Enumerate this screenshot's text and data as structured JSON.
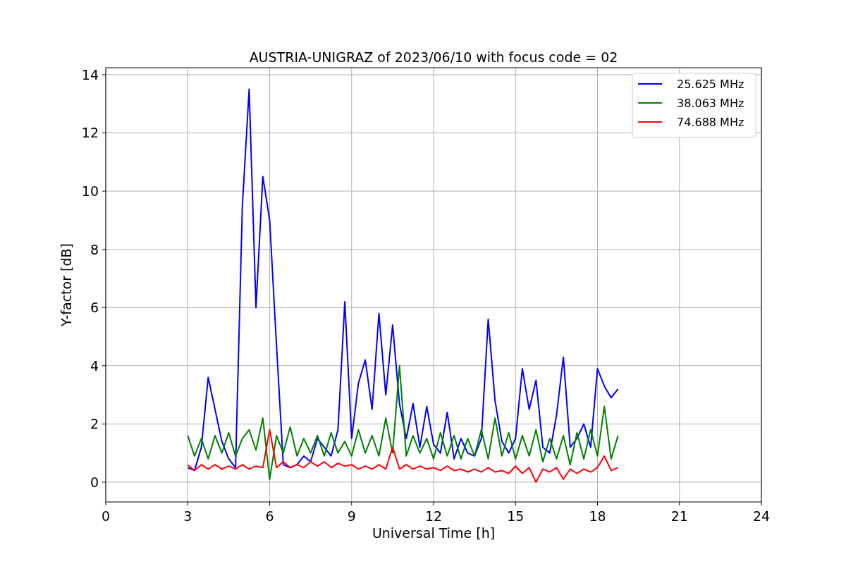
{
  "chart_data": {
    "type": "line",
    "title": "AUSTRIA-UNIGRAZ of 2023/06/10 with focus code = 02",
    "xlabel": "Universal Time [h]",
    "ylabel": "Y-factor [dB]",
    "x": [
      3,
      3.25,
      3.5,
      3.75,
      4,
      4.25,
      4.5,
      4.75,
      5,
      5.25,
      5.5,
      5.75,
      6,
      6.25,
      6.5,
      6.75,
      7,
      7.25,
      7.5,
      7.75,
      8,
      8.25,
      8.5,
      8.75,
      9,
      9.25,
      9.5,
      9.75,
      10,
      10.25,
      10.5,
      10.75,
      11,
      11.25,
      11.5,
      11.75,
      12,
      12.25,
      12.5,
      12.75,
      13,
      13.25,
      13.5,
      13.75,
      14,
      14.25,
      14.5,
      14.75,
      15,
      15.25,
      15.5,
      15.75,
      16,
      16.25,
      16.5,
      16.75,
      17,
      17.25,
      17.5,
      17.75,
      18,
      18.25,
      18.5,
      18.75
    ],
    "series": [
      {
        "name": "25.625 MHz",
        "color": "#0000ff",
        "values": [
          0.5,
          0.4,
          1.2,
          3.6,
          2.5,
          1.4,
          0.8,
          0.5,
          9.5,
          13.5,
          6,
          10.5,
          9.0,
          4.7,
          0.6,
          0.5,
          0.6,
          0.9,
          0.7,
          1.5,
          1.2,
          0.9,
          1.8,
          6.2,
          1.5,
          3.4,
          4.2,
          2.5,
          5.8,
          3.0,
          5.4,
          2.7,
          1.5,
          2.7,
          1.2,
          2.6,
          1.3,
          1.0,
          2.4,
          0.8,
          1.5,
          1.0,
          0.9,
          1.5,
          5.6,
          2.8,
          1.4,
          1.0,
          1.5,
          3.9,
          2.5,
          3.5,
          1.2,
          1.0,
          2.3,
          4.3,
          1.2,
          1.5,
          2.0,
          1.2,
          3.9,
          3.3,
          2.9,
          3.2
        ]
      },
      {
        "name": "38.063 MHz",
        "color": "#008000",
        "values": [
          1.6,
          0.9,
          1.5,
          0.8,
          1.6,
          1.0,
          1.7,
          0.9,
          1.5,
          1.8,
          1.1,
          2.2,
          0.1,
          1.6,
          1.0,
          1.9,
          0.9,
          1.5,
          1.0,
          1.6,
          0.9,
          1.7,
          1.0,
          1.4,
          0.9,
          1.8,
          1.0,
          1.6,
          0.9,
          2.2,
          1.0,
          4.0,
          0.9,
          1.6,
          1.0,
          1.5,
          0.8,
          1.7,
          0.9,
          1.6,
          0.8,
          1.5,
          0.9,
          1.8,
          0.8,
          2.2,
          0.9,
          1.7,
          0.8,
          1.6,
          0.9,
          1.8,
          0.7,
          1.5,
          0.8,
          1.6,
          0.6,
          1.7,
          0.8,
          1.8,
          0.9,
          2.6,
          0.8,
          1.6
        ]
      },
      {
        "name": "74.688 MHz",
        "color": "#ff0000",
        "values": [
          0.6,
          0.4,
          0.6,
          0.45,
          0.6,
          0.45,
          0.55,
          0.45,
          0.6,
          0.45,
          0.55,
          0.5,
          1.8,
          0.5,
          0.7,
          0.5,
          0.6,
          0.5,
          0.7,
          0.55,
          0.7,
          0.5,
          0.65,
          0.55,
          0.6,
          0.45,
          0.55,
          0.45,
          0.6,
          0.45,
          1.2,
          0.45,
          0.6,
          0.45,
          0.55,
          0.45,
          0.5,
          0.4,
          0.55,
          0.4,
          0.45,
          0.35,
          0.45,
          0.35,
          0.5,
          0.35,
          0.4,
          0.3,
          0.55,
          0.3,
          0.5,
          0.0,
          0.45,
          0.35,
          0.5,
          0.1,
          0.45,
          0.3,
          0.45,
          0.35,
          0.5,
          0.9,
          0.4,
          0.5
        ]
      }
    ],
    "xlim": [
      0,
      24
    ],
    "ylim": [
      -0.68,
      14.24
    ],
    "xticks": [
      0,
      3,
      6,
      9,
      12,
      15,
      18,
      21,
      24
    ],
    "yticks": [
      0,
      2,
      4,
      6,
      8,
      10,
      12,
      14
    ],
    "grid": true,
    "legend": true
  }
}
